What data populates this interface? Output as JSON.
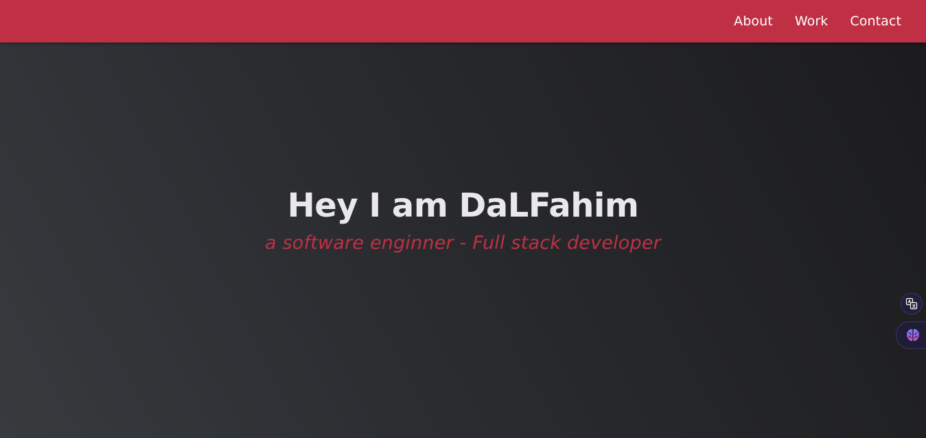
{
  "nav": {
    "links": [
      {
        "label": "About"
      },
      {
        "label": "Work"
      },
      {
        "label": "Contact"
      }
    ]
  },
  "hero": {
    "title": "Hey I am DaLFahim",
    "subtitle": "a software enginner - Full stack developer"
  },
  "floating_widgets": [
    {
      "icon": "translate-icon"
    },
    {
      "icon": "brain-icon"
    }
  ],
  "colors": {
    "accent": "#c03045",
    "background_light": "#373b3e",
    "background_dark": "#1b1b1d",
    "title_text": "#e9e9ec"
  }
}
